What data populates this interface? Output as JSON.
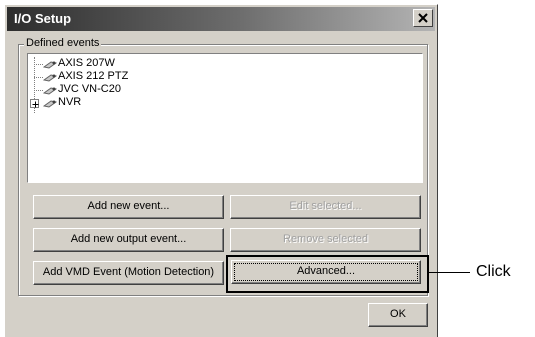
{
  "window": {
    "title": "I/O Setup"
  },
  "group": {
    "label": "Defined events"
  },
  "tree": {
    "items": [
      {
        "label": "AXIS 207W",
        "icon": "camera-icon",
        "expandable": false
      },
      {
        "label": "AXIS 212 PTZ",
        "icon": "camera-icon",
        "expandable": false
      },
      {
        "label": "JVC VN-C20",
        "icon": "camera-icon",
        "expandable": false
      },
      {
        "label": "NVR",
        "icon": "camera-icon",
        "expandable": true,
        "expanded": false
      }
    ]
  },
  "buttons": {
    "add_new_event": "Add new event...",
    "edit_selected": "Edit selected...",
    "add_new_output_event": "Add new output event...",
    "remove_selected": "Remove selected",
    "add_vmd_event": "Add VMD Event (Motion Detection)",
    "advanced": "Advanced...",
    "ok": "OK"
  },
  "annotation": {
    "callout": "Click"
  }
}
